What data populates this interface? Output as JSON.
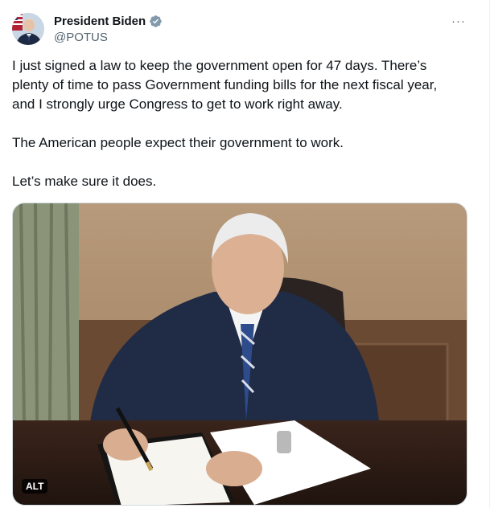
{
  "author": {
    "display_name": "President Biden",
    "handle": "@POTUS",
    "verified_icon": "verified-badge-icon",
    "avatar_icon": "avatar-image"
  },
  "tweet": {
    "paragraphs": [
      "I just signed a law to keep the government open for 47 days. There’s plenty of time to pass Government funding bills for the next fiscal year, and I strongly urge Congress to get to work right away.",
      "The American people expect their government to work.",
      "Let’s make sure it does."
    ]
  },
  "media": {
    "alt_label": "ALT"
  },
  "menu": {
    "more_icon": "more-options-icon",
    "more_label": "···"
  },
  "colors": {
    "verified": "#829aab",
    "text": "#0f1419",
    "secondary": "#536471"
  }
}
